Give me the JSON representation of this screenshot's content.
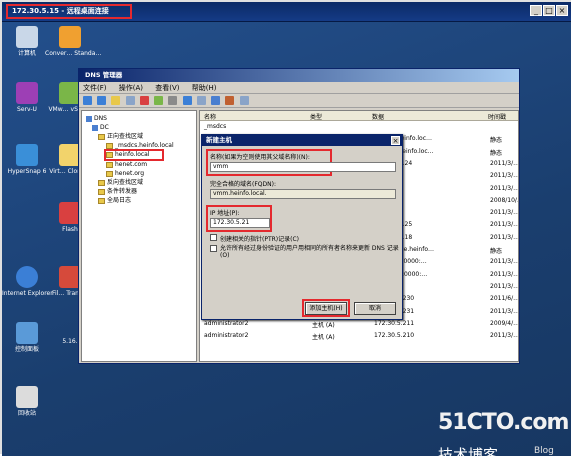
{
  "rdp": {
    "title": "172.30.5.15 - 远程桌面连接",
    "min": "_",
    "max": "□",
    "close": "×"
  },
  "desktop": {
    "icons": [
      {
        "label": "计算机",
        "name": "computer-icon",
        "color": "#c9d7e8"
      },
      {
        "label": "Conver… Standa…",
        "name": "converter-icon",
        "color": "#f0a030"
      },
      {
        "label": "Serv-U",
        "name": "servu-icon",
        "color": "#9d3fb5"
      },
      {
        "label": "VMw… vSph…",
        "name": "vmware-icon",
        "color": "#7ab648"
      },
      {
        "label": "HyperSnap 6",
        "name": "hypersnap-icon",
        "color": "#3a8fd8"
      },
      {
        "label": "Virt… Clone…",
        "name": "virtclone-icon",
        "color": "#f2d36b"
      },
      {
        "label": "Flash",
        "name": "flash-icon",
        "color": "#d94040"
      },
      {
        "label": "Internet Explorer",
        "name": "ie-icon",
        "color": "#3b7fd6"
      },
      {
        "label": "Fil… Trans…",
        "name": "filetransfer-icon",
        "color": "#d64a3b"
      },
      {
        "label": "控制面板",
        "name": "control-panel-icon",
        "color": "#5a9ad8"
      },
      {
        "label": "5.16.",
        "name": "rdp-shortcut-icon",
        "color": "#3d6fb0"
      },
      {
        "label": "回收站",
        "name": "recycle-bin-icon",
        "color": "#dcdcdc"
      }
    ]
  },
  "dns": {
    "title": "DNS 管理器",
    "menu": [
      "文件(F)",
      "操作(A)",
      "查看(V)",
      "帮助(H)"
    ],
    "tree": {
      "root": "DNS",
      "server": "DC",
      "forward": "正向查找区域",
      "msdcs": "_msdcs.heinfo.local",
      "heinfo": "heinfo.local",
      "henet_com": "henet.com",
      "henet_org": "henet.org",
      "reverse": "反向查找区域",
      "conditional": "条件转发器",
      "global": "全局日志"
    },
    "list": {
      "headers": [
        "名称",
        "类型",
        "数据",
        "时间戳"
      ],
      "rows": [
        {
          "name": "_msdcs",
          "type": "",
          "data": "",
          "ts": ""
        },
        {
          "name": "",
          "type": "",
          "data": "10], dc.heinfo.loc…",
          "ts": "静态"
        },
        {
          "name": "",
          "type": "",
          "data": "ucenter.heinfo.loc…",
          "ts": "静态"
        },
        {
          "name": "",
          "type": "",
          "data": "206.197.124",
          "ts": "2011/3/…"
        },
        {
          "name": "",
          "type": "",
          "data": "30.5.15",
          "ts": "2011/3/…"
        },
        {
          "name": "",
          "type": "",
          "data": "30.5.121",
          "ts": "2011/3/…"
        },
        {
          "name": "",
          "type": "",
          "data": "30.5.50",
          "ts": "2008/10/…"
        },
        {
          "name": "",
          "type": "",
          "data": "30.5.230",
          "ts": "2011/3/…"
        },
        {
          "name": "",
          "type": "",
          "data": "206.197.125",
          "ts": "2011/3/…"
        },
        {
          "name": "",
          "type": "",
          "data": "206.197.118",
          "ts": "2011/3/…"
        },
        {
          "name": "",
          "type": "",
          "data": "] exchange.heinfo…",
          "ts": "静态"
        },
        {
          "name": "",
          "type": "",
          "data": "ace:d57c:0000:…",
          "ts": "2011/3/…"
        },
        {
          "name": "",
          "type": "",
          "data": "ace:d57b:0000:…",
          "ts": "2011/3/…"
        },
        {
          "name": "",
          "type": "",
          "data": "24.1.56",
          "ts": "2011/3/…"
        },
        {
          "name": "ADD2",
          "type": "主机 (A)",
          "data": "172.30.5.230",
          "ts": "2011/6/…"
        },
        {
          "name": "add3",
          "type": "主机 (A)",
          "data": "172.30.5.231",
          "ts": "2011/3/…"
        },
        {
          "name": "administrator2",
          "type": "主机 (A)",
          "data": "172.30.5.211",
          "ts": "2009/4/…"
        },
        {
          "name": "administrator2",
          "type": "主机 (A)",
          "data": "172.30.5.210",
          "ts": "2011/3/…"
        }
      ]
    }
  },
  "dialog": {
    "title": "新建主机",
    "name_label": "名称(如果为空则使用其父域名称)(N):",
    "name_value": "vmm",
    "fqdn_label": "完全合格的域名(FQDN):",
    "fqdn_value": "vmm.heinfo.local.",
    "ip_label": "IP 地址(P):",
    "ip_value": "172.30.5.21",
    "ptr_label": "创建相关的指针(PTR)记录(C)",
    "auth_label": "允许所有经过身份验证的用户用相同的所有者名称来更新 DNS 记录(O)",
    "add_button": "添加主机(H)",
    "cancel_button": "取消",
    "close": "×"
  },
  "watermark": {
    "main": "51CTO.com",
    "sub": "技术博客",
    "blog": "Blog"
  }
}
